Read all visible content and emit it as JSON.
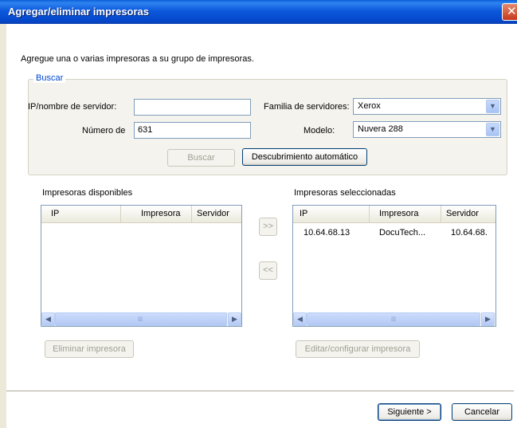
{
  "window": {
    "title": "Agregar/eliminar impresoras"
  },
  "intro_text": "Agregue una o varias impresoras a su grupo de impresoras.",
  "search": {
    "legend": "Buscar",
    "ip_label": "IP/nombre de servidor:",
    "ip_value": "",
    "number_label": "Número de",
    "number_value": "631",
    "family_label": "Familia de servidores:",
    "family_value": "Xerox",
    "model_label": "Modelo:",
    "model_value": "Nuvera 288",
    "search_button": "Buscar",
    "autodiscover_button": "Descubrimiento automático"
  },
  "available": {
    "label": "Impresoras disponibles",
    "columns": [
      "IP",
      "Impresora",
      "Servidor"
    ],
    "rows": [],
    "remove_button": "Eliminar impresora"
  },
  "move": {
    "add": ">>",
    "remove": "<<"
  },
  "selected": {
    "label": "Impresoras seleccionadas",
    "columns": [
      "IP",
      "Impresora",
      "Servidor"
    ],
    "rows": [
      [
        "10.64.68.13",
        "DocuTech...",
        "10.64.68."
      ]
    ],
    "edit_button": "Editar/configurar impresora"
  },
  "footer": {
    "next_button": "Siguiente >",
    "cancel_button": "Cancelar"
  },
  "colors": {
    "titlebar": "#0548cc",
    "legend": "#0046d5",
    "dialog_bg": "#ece9d8"
  }
}
